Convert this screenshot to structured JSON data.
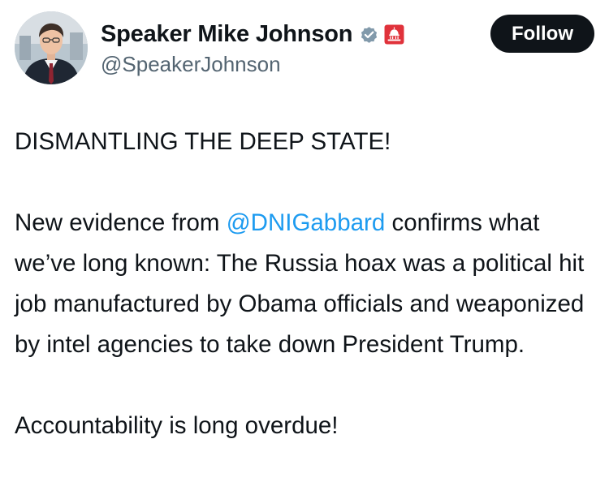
{
  "author": {
    "display_name": "Speaker Mike Johnson",
    "handle": "@SpeakerJohnson",
    "verified_icon": "verified-badge-icon",
    "affiliation_icon": "capitol-dome-icon",
    "verified_color": "#829aab",
    "affiliation_color": "#e0323b"
  },
  "follow_button": {
    "label": "Follow",
    "background": "#0f1419",
    "text_color": "#ffffff"
  },
  "post": {
    "headline": "DISMANTLING THE DEEP STATE!",
    "paragraph_before_mention": "New evidence from ",
    "mention": "@DNIGabbard",
    "paragraph_after_mention": " confirms what we’ve long known: The Russia hoax was a political hit job manufactured by Obama officials and weaponized by intel agencies to take down President Trump.",
    "closing": "Accountability is long overdue!",
    "mention_color": "#1d9bf0"
  }
}
